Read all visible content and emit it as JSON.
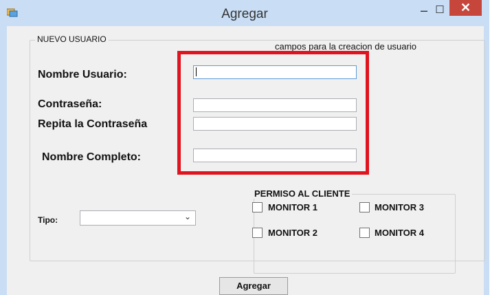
{
  "window": {
    "title": "Agregar",
    "minimize_glyph": "–",
    "maximize_glyph": "☐",
    "close_glyph": "✕",
    "app_icon": "form-app-icon",
    "colors": {
      "frame": "#c9def5",
      "close": "#c7463c",
      "highlight": "#e0141f"
    }
  },
  "main_group": {
    "legend": "NUEVO USUARIO",
    "note": "campos para la creacion de usuario"
  },
  "fields": {
    "username_label": "Nombre Usuario:",
    "password_label": "Contraseña:",
    "repeat_password_label": "Repita la Contraseña",
    "fullname_label": "Nombre Completo:",
    "username_value": "",
    "password_value": "",
    "repeat_password_value": "",
    "fullname_value": ""
  },
  "tipo": {
    "label": "Tipo:",
    "selected": ""
  },
  "permissions": {
    "legend": "PERMISO AL CLIENTE",
    "monitor1": "MONITOR 1",
    "monitor2": "MONITOR 2",
    "monitor3": "MONITOR 3",
    "monitor4": "MONITOR 4"
  },
  "submit": {
    "label": "Agregar"
  }
}
